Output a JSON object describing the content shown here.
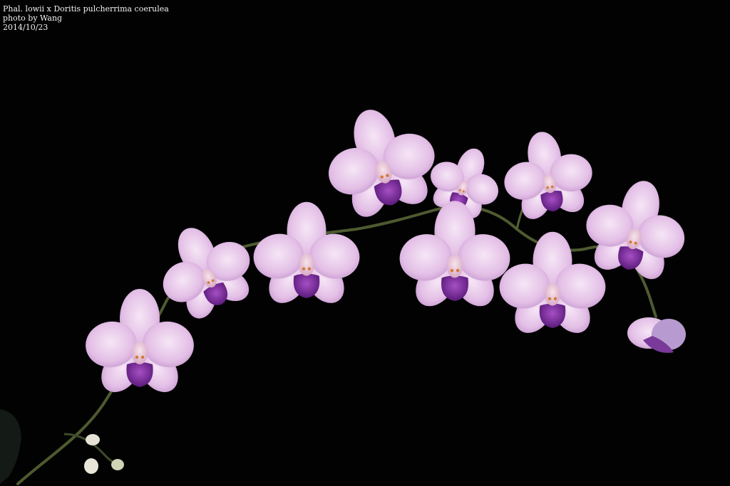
{
  "caption": {
    "line1": "Phal. lowii x Doritis pulcherrima coerulea",
    "line2": "photo by Wang",
    "line3": "2014/10/23"
  },
  "colors": {
    "background": "#020202",
    "petal_pink": "#e6c6e6",
    "lip_purple": "#7a2a9a",
    "stem_green": "#5d6b3a"
  }
}
